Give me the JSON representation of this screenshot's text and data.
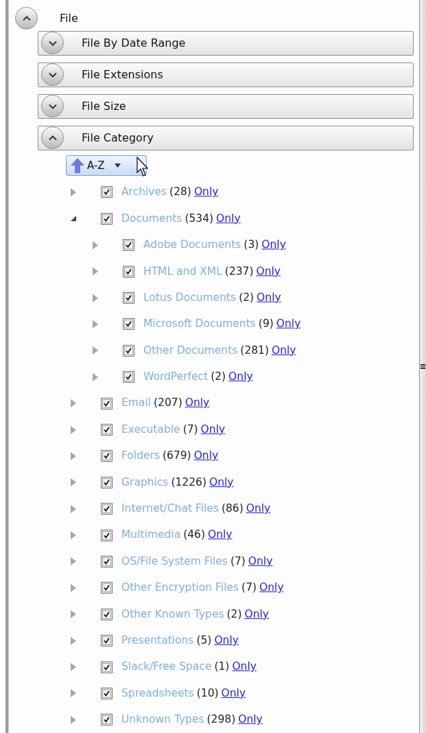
{
  "panel": {
    "title": "File",
    "expanded": true
  },
  "sections": [
    {
      "title": "File By Date Range",
      "expanded": false
    },
    {
      "title": "File Extensions",
      "expanded": false
    },
    {
      "title": "File Size",
      "expanded": false
    },
    {
      "title": "File Category",
      "expanded": true
    }
  ],
  "sort_button": {
    "label": "A-Z"
  },
  "tree": [
    {
      "label": "Archives",
      "count": "(28)",
      "link": "Only",
      "checked": true,
      "expanded": false
    },
    {
      "label": "Documents",
      "count": "(534)",
      "link": "Only",
      "checked": true,
      "expanded": true,
      "children": [
        {
          "label": "Adobe Documents",
          "count": "(3)",
          "link": "Only",
          "checked": true,
          "expanded": false
        },
        {
          "label": "HTML and XML",
          "count": "(237)",
          "link": "Only",
          "checked": true,
          "expanded": false
        },
        {
          "label": "Lotus Documents",
          "count": "(2)",
          "link": "Only",
          "checked": true,
          "expanded": false
        },
        {
          "label": "Microsoft Documents",
          "count": "(9)",
          "link": "Only",
          "checked": true,
          "expanded": false
        },
        {
          "label": "Other Documents",
          "count": "(281)",
          "link": "Only",
          "checked": true,
          "expanded": false
        },
        {
          "label": "WordPerfect",
          "count": "(2)",
          "link": "Only",
          "checked": true,
          "expanded": false
        }
      ]
    },
    {
      "label": "Email",
      "count": "(207)",
      "link": "Only",
      "checked": true,
      "expanded": false
    },
    {
      "label": "Executable",
      "count": "(7)",
      "link": "Only",
      "checked": true,
      "expanded": false
    },
    {
      "label": "Folders",
      "count": "(679)",
      "link": "Only",
      "checked": true,
      "expanded": false
    },
    {
      "label": "Graphics",
      "count": "(1226)",
      "link": "Only",
      "checked": true,
      "expanded": false
    },
    {
      "label": "Internet/Chat Files",
      "count": "(86)",
      "link": "Only",
      "checked": true,
      "expanded": false
    },
    {
      "label": "Multimedia",
      "count": "(46)",
      "link": "Only",
      "checked": true,
      "expanded": false
    },
    {
      "label": "OS/File System Files",
      "count": "(7)",
      "link": "Only",
      "checked": true,
      "expanded": false
    },
    {
      "label": "Other Encryption Files",
      "count": "(7)",
      "link": "Only",
      "checked": true,
      "expanded": false
    },
    {
      "label": "Other Known Types",
      "count": "(2)",
      "link": "Only",
      "checked": true,
      "expanded": false
    },
    {
      "label": "Presentations",
      "count": "(5)",
      "link": "Only",
      "checked": true,
      "expanded": false
    },
    {
      "label": "Slack/Free Space",
      "count": "(1)",
      "link": "Only",
      "checked": true,
      "expanded": false
    },
    {
      "label": "Spreadsheets",
      "count": "(10)",
      "link": "Only",
      "checked": true,
      "expanded": false
    },
    {
      "label": "Unknown Types",
      "count": "(298)",
      "link": "Only",
      "checked": true,
      "expanded": false
    }
  ]
}
